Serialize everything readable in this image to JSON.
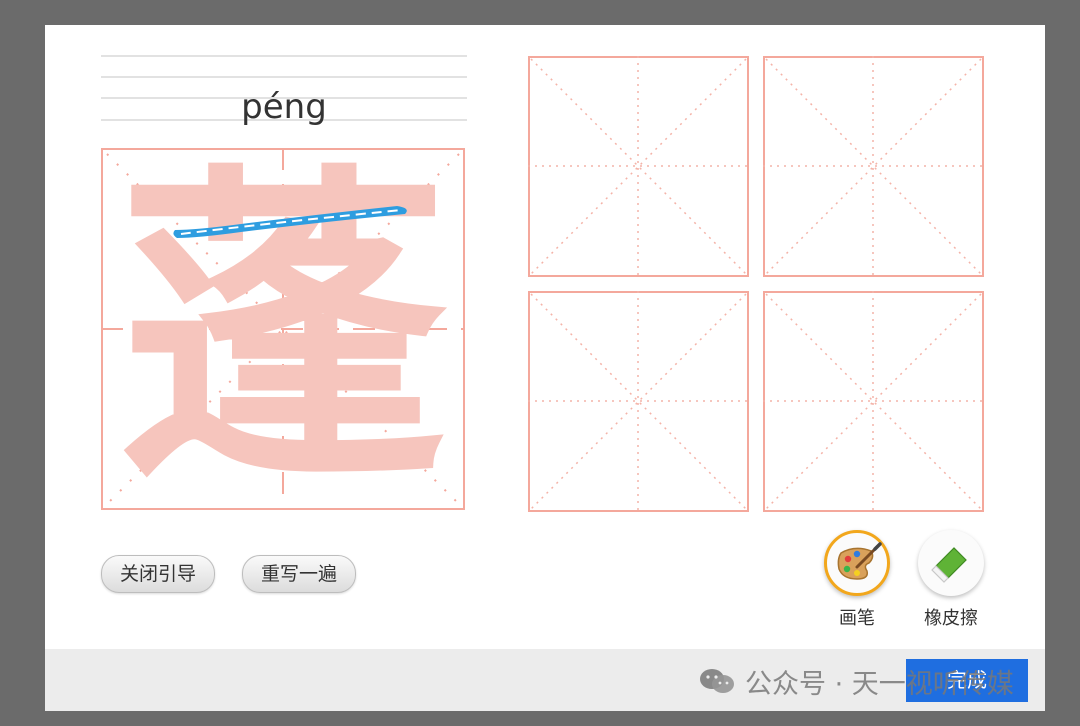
{
  "pinyin": "péng",
  "character": "蓬",
  "buttons": {
    "close_guide": "关闭引导",
    "rewrite": "重写一遍"
  },
  "tools": {
    "brush": "画笔",
    "eraser": "橡皮擦",
    "active": "brush"
  },
  "footer": {
    "done": "完成",
    "watermark": "公众号 · 天一视听传媒"
  },
  "colors": {
    "grid": "#f4a89c",
    "guide_char": "#f6c5bd",
    "stroke_highlight": "#2e9de0",
    "done_button": "#1f6ee0",
    "active_tool_ring": "#f2a71c"
  },
  "practice_boxes": [
    "box-1",
    "box-2",
    "box-3",
    "box-4"
  ]
}
